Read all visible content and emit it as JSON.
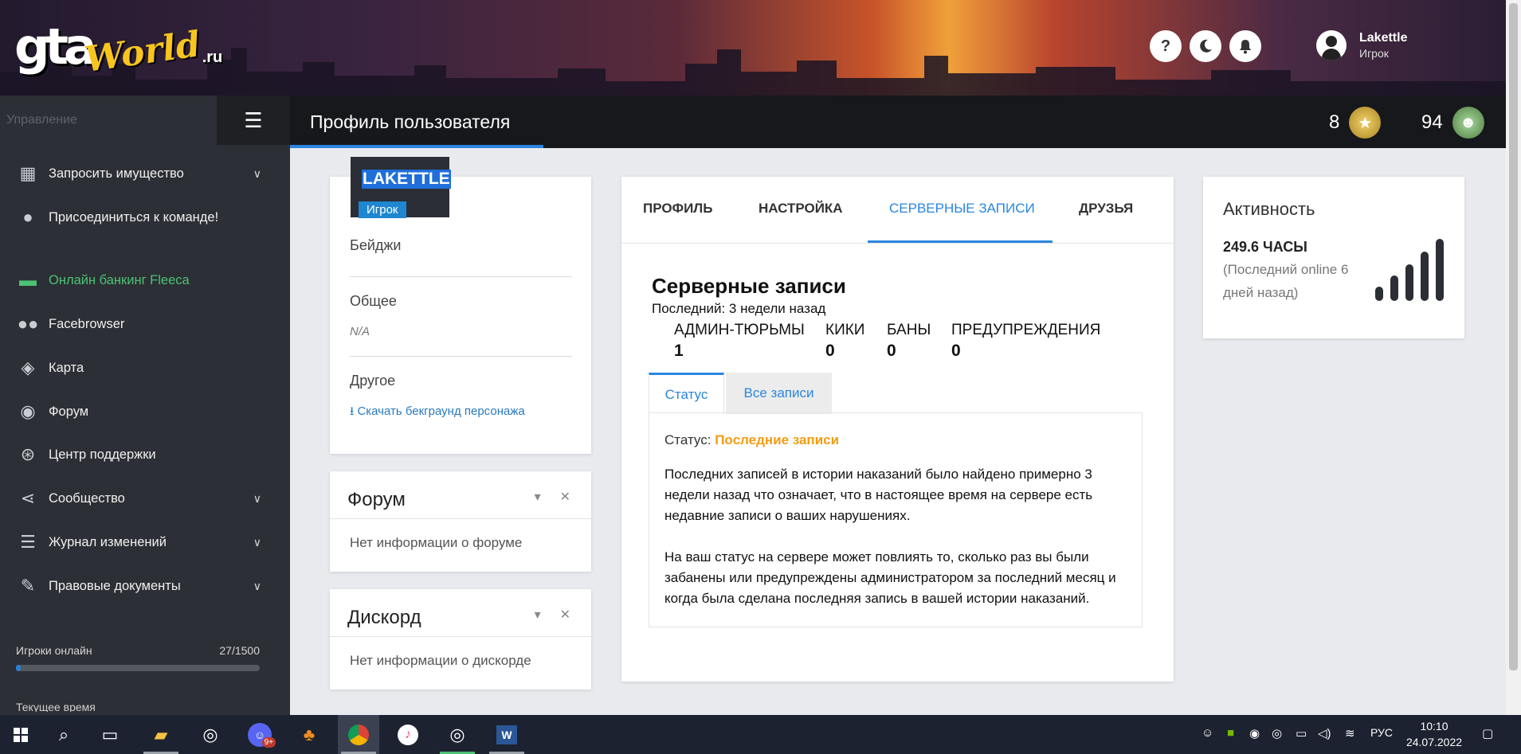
{
  "header": {
    "logo": {
      "gta": "gta",
      "world": "World",
      "ru": ".ru"
    },
    "icons": [
      "help-icon",
      "moon-icon",
      "bell-icon"
    ],
    "help_glyph": "?",
    "user": {
      "name": "Lakettle",
      "role": "Игрок"
    }
  },
  "sidebar": {
    "manage_label": "Управление",
    "items": [
      {
        "label": "Запросить имущество",
        "icon": "building-icon",
        "chevron": true
      },
      {
        "label": "Присоединиться к команде!",
        "icon": "user-tie-icon",
        "chevron": false
      },
      {
        "label": "Онлайн банкинг Fleeca",
        "icon": "money-icon",
        "chevron": false,
        "color": "#4cc274"
      },
      {
        "label": "Facebrowser",
        "icon": "users-icon",
        "chevron": false
      },
      {
        "label": "Карта",
        "icon": "map-icon",
        "chevron": false
      },
      {
        "label": "Форум",
        "icon": "comments-icon",
        "chevron": false
      },
      {
        "label": "Центр поддержки",
        "icon": "life-ring-icon",
        "chevron": false
      },
      {
        "label": "Сообщество",
        "icon": "share-icon",
        "chevron": true
      },
      {
        "label": "Журнал изменений",
        "icon": "list-icon",
        "chevron": true
      },
      {
        "label": "Правовые документы",
        "icon": "file-signature-icon",
        "chevron": true
      }
    ],
    "players_label": "Игроки онлайн",
    "players_count": "27/1500",
    "players_online": 27,
    "players_max": 1500,
    "time_label": "Текущее время"
  },
  "titlebar": {
    "title": "Профиль пользователя",
    "score_left": "8",
    "score_right": "94"
  },
  "profile": {
    "username": "LAKETTLE",
    "role": "Игрок",
    "badges_label": "Бейджи",
    "general_label": "Общее",
    "general_value": "N/A",
    "other_label": "Другое",
    "download_link": "Скачать бекграунд персонажа"
  },
  "forum_card": {
    "title": "Форум",
    "body": "Нет информации о форуме"
  },
  "discord_card": {
    "title": "Дискорд",
    "body": "Нет информации о дискорде"
  },
  "main": {
    "tabs": [
      "ПРОФИЛЬ",
      "НАСТРОЙКА",
      "СЕРВЕРНЫЕ ЗАПИСИ",
      "ДРУЗЬЯ"
    ],
    "active_tab": "СЕРВЕРНЫЕ ЗАПИСИ",
    "section_title": "Серверные записи",
    "last": "Последний: 3 недели назад",
    "stats": [
      {
        "label": "АДМИН-ТЮРЬМЫ",
        "value": "1"
      },
      {
        "label": "КИКИ",
        "value": "0"
      },
      {
        "label": "БАНЫ",
        "value": "0"
      },
      {
        "label": "ПРЕДУПРЕЖДЕНИЯ",
        "value": "0"
      }
    ],
    "subtabs": [
      "Статус",
      "Все записи"
    ],
    "status_prefix": "Статус:",
    "status_value": "Последние записи",
    "status_color": "#f39c12",
    "para1": "Последних записей в истории наказаний было найдено примерно 3 недели назад что означает, что в настоящее время на сервере есть недавние записи о ваших нарушениях.",
    "para2": "На ваш статус на сервере может повлиять то, сколько раз вы были забанены или предупреждены администратором за последний месяц и когда была сделана последняя запись в вашей истории наказаний."
  },
  "activity": {
    "title": "Активность",
    "hours": "249.6 ЧАСЫ",
    "desc": "(Последний online 6 дней назад)",
    "signal_level": 5
  },
  "taskbar": {
    "lang": "РУС",
    "time": "10:10",
    "date": "24.07.2022",
    "badge": "9+"
  },
  "colors": {
    "accent": "#2a86e0",
    "sidebar": "#2c2f35",
    "titlebar": "#17181b",
    "green": "#4cc274"
  }
}
